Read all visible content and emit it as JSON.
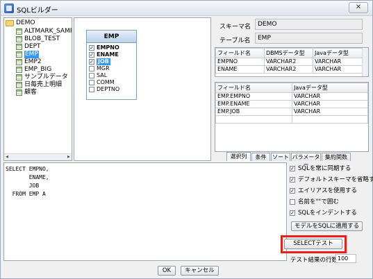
{
  "window": {
    "title": "SQLビルダー",
    "close_label": "✕"
  },
  "tree": {
    "root": "DEMO",
    "items": [
      "ALTMARK_SAMPLE",
      "BLOB_TEST",
      "DEPT",
      "EMP",
      "EMP2",
      "EMP_BIG",
      "サンプルデータ",
      "日毎売上明細",
      "顧客"
    ],
    "selected": "EMP",
    "scroll_left": "◂",
    "scroll_right": "▸"
  },
  "diagram": {
    "table_name": "EMP",
    "columns": [
      {
        "name": "EMPNO",
        "checked": true
      },
      {
        "name": "ENAME",
        "checked": true
      },
      {
        "name": "JOB",
        "checked": true,
        "selected": true
      },
      {
        "name": "MGR",
        "checked": false
      },
      {
        "name": "SAL",
        "checked": false
      },
      {
        "name": "COMM",
        "checked": false
      },
      {
        "name": "DEPTNO",
        "checked": false
      }
    ]
  },
  "info": {
    "schema_label": "スキーマ名",
    "schema_value": "DEMO",
    "table_label": "テーブル名",
    "table_value": "EMP"
  },
  "field_grid": {
    "headers": [
      "フィールド名",
      "DBMSデータ型",
      "Javaデータ型"
    ],
    "rows": [
      [
        "EMPNO",
        "VARCHAR2",
        "VARCHAR"
      ],
      [
        "ENAME",
        "VARCHAR2",
        "VARCHAR"
      ]
    ]
  },
  "selected_grid": {
    "headers": [
      "フィールド名",
      "Javaデータ型"
    ],
    "rows": [
      [
        "EMP.EMPNO",
        "VARCHAR"
      ],
      [
        "EMP.ENAME",
        "VARCHAR"
      ],
      [
        "EMP.JOB",
        "VARCHAR"
      ]
    ]
  },
  "tabs": [
    "選択列",
    "条件",
    "ソート",
    "パラメーター",
    "集約関数"
  ],
  "sql_text": "SELECT EMPNO,\n       ENAME,\n       JOB\n  FROM EMP A",
  "options": [
    {
      "label": "SQLを常に同期する",
      "checked": true
    },
    {
      "label": "デフォルトスキーマを省略する",
      "checked": true
    },
    {
      "label": "エイリアスを使用する",
      "checked": true
    },
    {
      "label": "名前を\"\"で囲む",
      "checked": false
    },
    {
      "label": "SQLをインデントする",
      "checked": true
    }
  ],
  "apply_button": "モデルをSQLに適用する",
  "select_test_button": "SELECTテスト",
  "rows_label": "テスト結果の行数",
  "rows_value": "100",
  "ok_button": "OK",
  "cancel_button": "キャンセル"
}
